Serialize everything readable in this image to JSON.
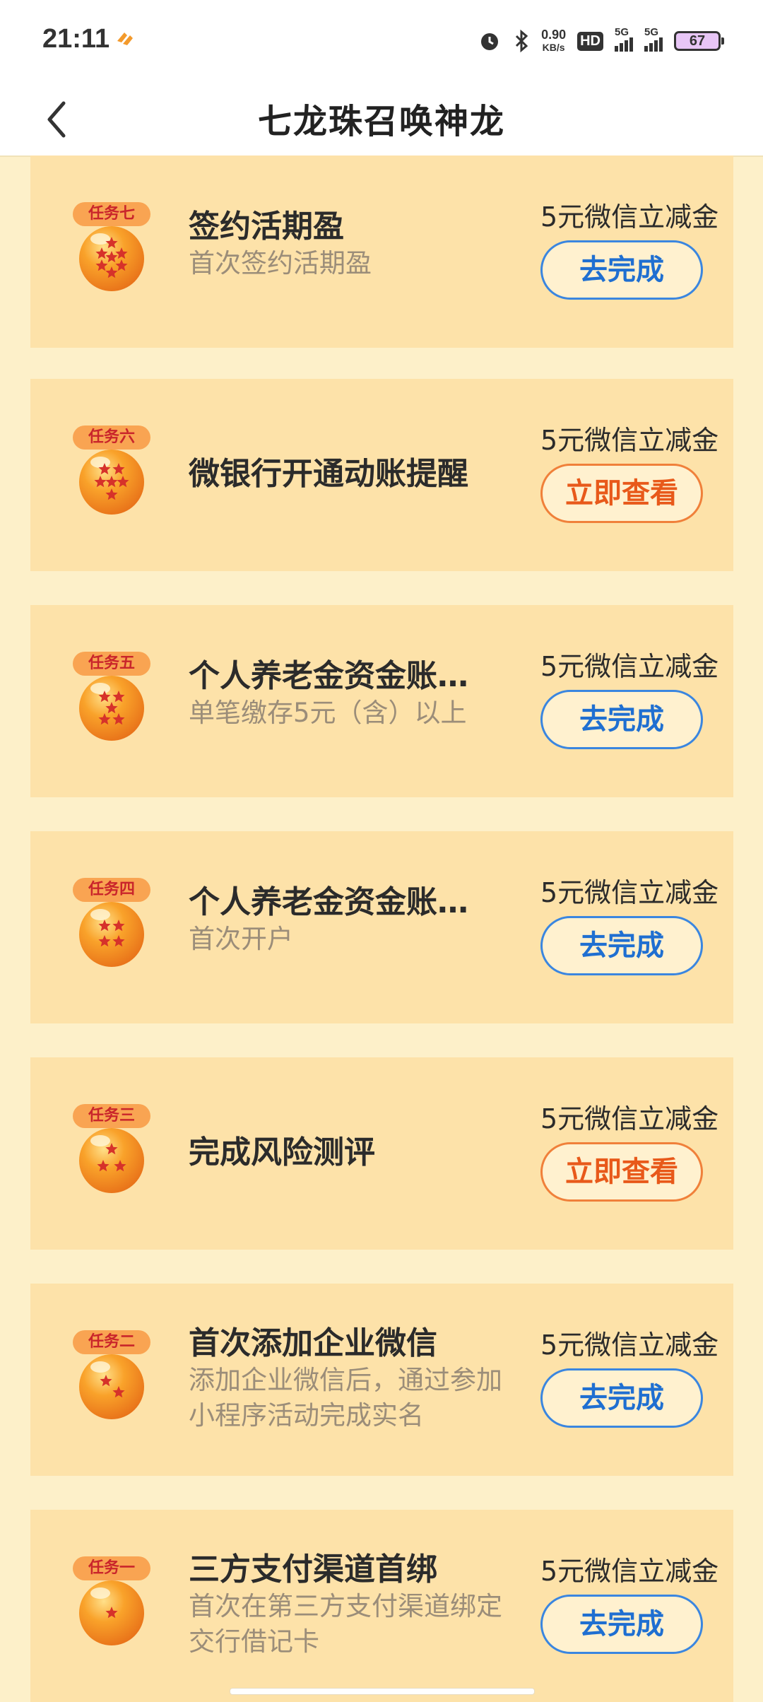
{
  "status": {
    "time": "21:11",
    "net_speed_value": "0.90",
    "net_speed_unit": "KB/s",
    "hd": "HD",
    "sim1": "5G",
    "sim2": "5G",
    "battery": "67"
  },
  "nav": {
    "title": "七龙珠召唤神龙"
  },
  "tasks": [
    {
      "badge": "任务七",
      "stars": 7,
      "title": "签约活期盈",
      "desc": "首次签约活期盈",
      "reward": "5元微信立减金",
      "button": "去完成",
      "button_style": "blue"
    },
    {
      "badge": "任务六",
      "stars": 6,
      "title": "微银行开通动账提醒",
      "desc": "",
      "reward": "5元微信立减金",
      "button": "立即查看",
      "button_style": "orange"
    },
    {
      "badge": "任务五",
      "stars": 5,
      "title": "个人养老金资金账户缴存",
      "desc": "单笔缴存5元（含）以上",
      "reward": "5元微信立减金",
      "button": "去完成",
      "button_style": "blue"
    },
    {
      "badge": "任务四",
      "stars": 4,
      "title": "个人养老金资金账户开户",
      "desc": "首次开户",
      "reward": "5元微信立减金",
      "button": "去完成",
      "button_style": "blue"
    },
    {
      "badge": "任务三",
      "stars": 3,
      "title": "完成风险测评",
      "desc": "",
      "reward": "5元微信立减金",
      "button": "立即查看",
      "button_style": "orange"
    },
    {
      "badge": "任务二",
      "stars": 2,
      "title": "首次添加企业微信",
      "desc": "添加企业微信后，通过参加小程序活动完成实名",
      "reward": "5元微信立减金",
      "button": "去完成",
      "button_style": "blue"
    },
    {
      "badge": "任务一",
      "stars": 1,
      "title": "三方支付渠道首绑",
      "desc": "首次在第三方支付渠道绑定交行借记卡",
      "reward": "5元微信立减金",
      "button": "去完成",
      "button_style": "blue"
    }
  ],
  "colors": {
    "page_bg": "#fdf0c9",
    "card_bg": "#fde2a9",
    "badge_bg": "#f9a452",
    "blue_button": "#1f6fd1",
    "orange_button": "#e8591a"
  }
}
